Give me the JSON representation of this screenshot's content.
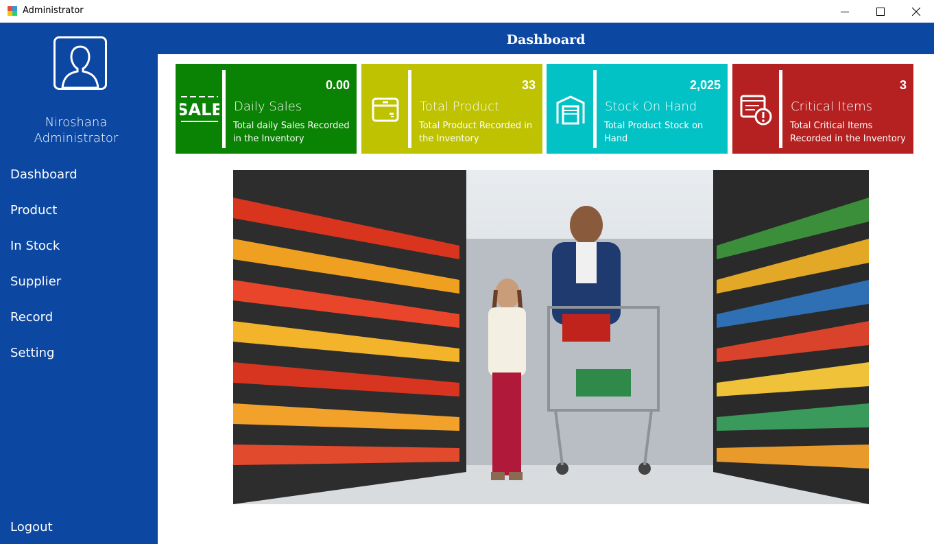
{
  "window": {
    "title": "Administrator",
    "controls": [
      "minimize-icon",
      "maximize-icon",
      "close-icon"
    ]
  },
  "sidebar": {
    "user": {
      "name": "Niroshana",
      "role": "Administrator",
      "avatar_icon": "user-silhouette-icon"
    },
    "nav": [
      {
        "label": "Dashboard"
      },
      {
        "label": "Product"
      },
      {
        "label": "In Stock"
      },
      {
        "label": "Supplier"
      },
      {
        "label": "Record"
      },
      {
        "label": "Setting"
      }
    ],
    "logout_label": "Logout"
  },
  "header": {
    "title": "Dashboard"
  },
  "cards": [
    {
      "title": "Daily Sales",
      "value": "0.00",
      "desc": "Total daily Sales Recorded in the Inventory",
      "icon": "sale-tag-icon",
      "color": "#0a8203"
    },
    {
      "title": "Total Product",
      "value": "33",
      "desc": "Total Product Recorded in the Inventory",
      "icon": "box-icon",
      "color": "#bfc201"
    },
    {
      "title": "Stock On Hand",
      "value": "2,025",
      "desc": "Total Product Stock on Hand",
      "icon": "warehouse-icon",
      "color": "#02c2c6"
    },
    {
      "title": "Critical Items",
      "value": "3",
      "desc": "Total Critical Items Recorded in the Inventory",
      "icon": "critical-list-icon",
      "color": "#b52121"
    }
  ],
  "colors": {
    "primary": "#0c47a1"
  },
  "hero": {
    "image": "supermarket-photo"
  }
}
